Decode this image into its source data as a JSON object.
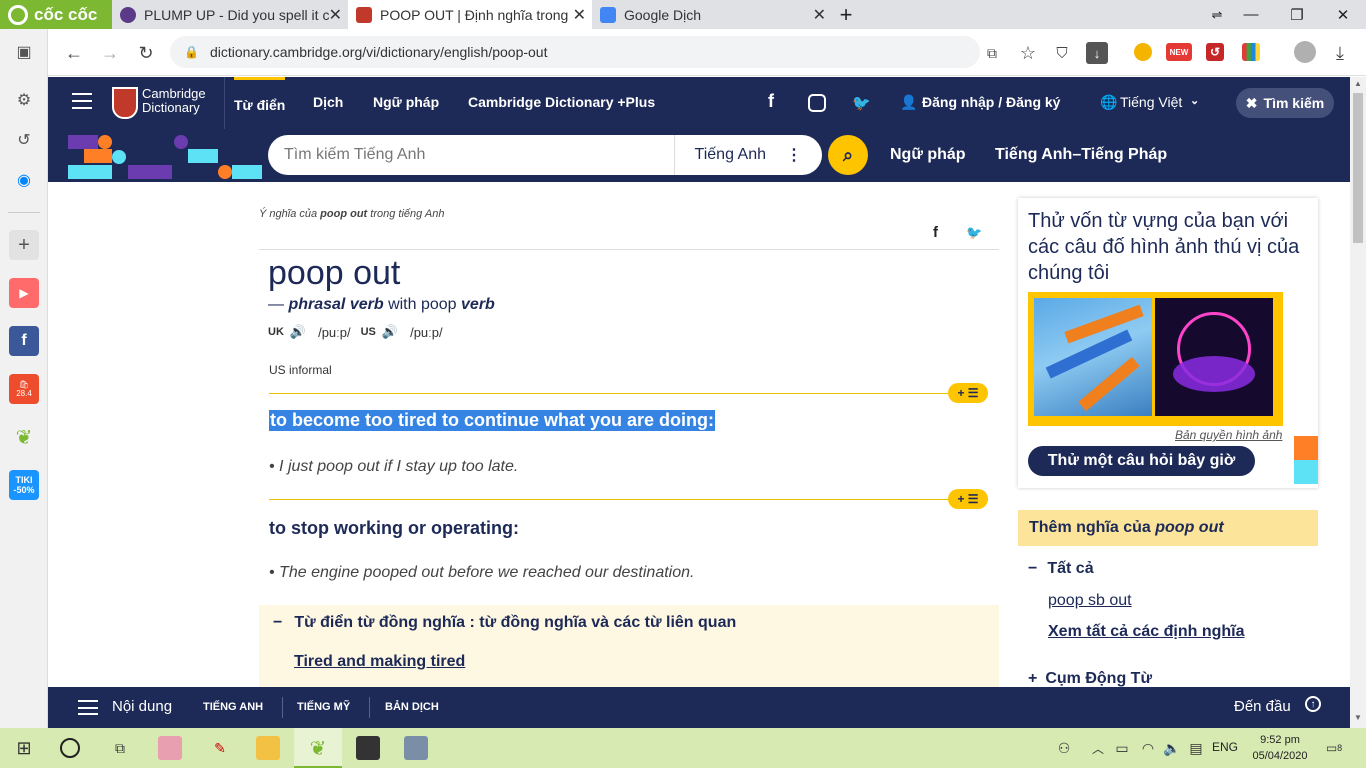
{
  "browser": {
    "brand": "cốc cốc",
    "tabs": [
      {
        "title": "PLUMP UP - Did you spell it c"
      },
      {
        "title": "POOP OUT | Định nghĩa trong"
      },
      {
        "title": "Google Dịch"
      }
    ],
    "url": "dictionary.cambridge.org/vi/dictionary/english/poop-out",
    "ext_new_badge": "NEW"
  },
  "sidebar": {
    "tiki_label": "TIKI",
    "tiki_discount": "-50%",
    "shopee_label": "28.4"
  },
  "header": {
    "logo_line1": "Cambridge",
    "logo_line2": "Dictionary",
    "nav": [
      "Từ điển",
      "Dịch",
      "Ngữ pháp",
      "Cambridge Dictionary +Plus"
    ],
    "login": "Đăng nhập / Đăng ký",
    "language": "Tiếng Việt",
    "search_toggle": "Tìm kiếm"
  },
  "search": {
    "placeholder": "Tìm kiếm Tiếng Anh",
    "dictionary": "Tiếng Anh",
    "links": [
      "Ngữ pháp",
      "Tiếng Anh–Tiếng Pháp"
    ]
  },
  "entry": {
    "meaning_prefix": "Ý nghĩa của",
    "meaning_word": "poop out",
    "meaning_suffix": "trong tiếng Anh",
    "headword": "poop out",
    "dash": "—",
    "pos": "phrasal verb",
    "with": "with poop",
    "pos2": "verb",
    "uk_label": "UK",
    "uk_pron": "/puːp/",
    "us_label": "US",
    "us_pron": "/puːp/",
    "usage": "US informal",
    "definitions": [
      {
        "text": "to become too tired to continue what you are doing:",
        "example": "I just poop out if I stay up too late."
      },
      {
        "text": "to stop working or operating:",
        "example": "The engine pooped out before we reached our destination."
      }
    ],
    "thesaurus_title": "Từ điển từ đồng nghĩa : từ đồng nghĩa và các từ liên quan",
    "thesaurus_link": "Tired and making tired"
  },
  "quiz": {
    "title": "Thử vốn từ vựng của bạn với các câu đố hình ảnh thú vị của chúng tôi",
    "credit": "Bản quyền hình ảnh",
    "button": "Thử một câu hỏi bây giờ"
  },
  "more": {
    "title_prefix": "Thêm nghĩa của",
    "title_word": "poop out",
    "all_label": "Tất cả",
    "link1": "poop sb out",
    "link2": "Xem tất cả các định nghĩa",
    "phrasal": "Cụm Động Từ"
  },
  "bottombar": {
    "contents": "Nội dung",
    "tabs": [
      "TIẾNG ANH",
      "TIẾNG MỸ",
      "BẢN DỊCH"
    ],
    "top": "Đến đầu"
  },
  "taskbar": {
    "lang": "ENG",
    "time": "9:52 pm",
    "date": "05/04/2020",
    "notifications": "8"
  },
  "colors": {
    "cambridge_navy": "#1d2a57",
    "highlight": "#3584e4",
    "yellow": "#fec400",
    "coccoc_green": "#7cb832"
  }
}
